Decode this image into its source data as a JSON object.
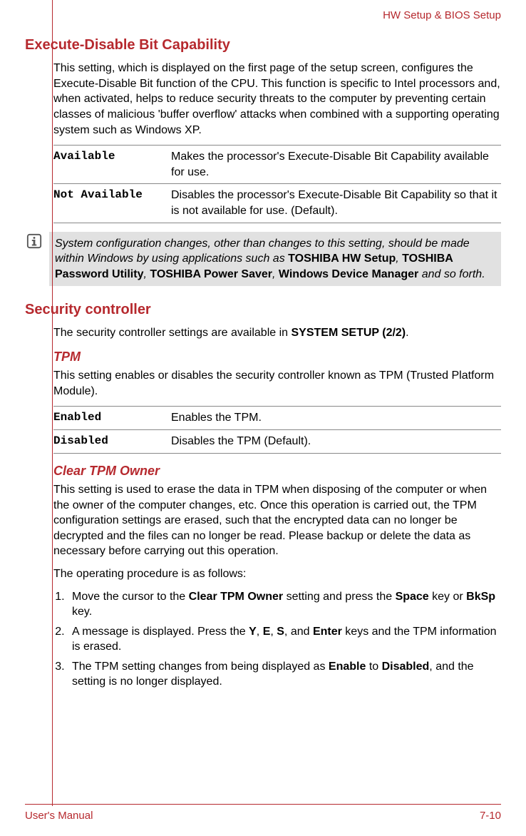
{
  "header": {
    "section": "HW Setup & BIOS Setup"
  },
  "exec": {
    "heading": "Execute-Disable Bit Capability",
    "intro": "This setting, which is displayed on the first page of the setup screen, configures the Execute-Disable Bit function of the CPU. This function is specific to Intel processors and, when activated, helps to reduce security threats to the computer by preventing certain classes of malicious 'buffer overflow' attacks when combined with a supporting operating system such as Windows XP.",
    "rows": [
      {
        "key": "Available",
        "desc": "Makes the processor's Execute-Disable Bit Capability available for use."
      },
      {
        "key": "Not Available",
        "desc": "Disables the processor's Execute-Disable Bit Capability so that it is not available for use. (Default)."
      }
    ]
  },
  "note": {
    "pre": "System configuration changes, other than changes to this setting, should be made within Windows by using applications such as ",
    "b1": "TOSHIBA HW Setup",
    "s1": ", ",
    "b2": "TOSHIBA Password Utility",
    "s2": ", ",
    "b3": "TOSHIBA Power Saver",
    "s3": ", ",
    "b4": "Windows Device Manager",
    "post": " and so forth."
  },
  "sec": {
    "heading": "Security controller",
    "intro_pre": "The security controller settings are available in ",
    "intro_bold": "SYSTEM SETUP (2/2)",
    "intro_post": ".",
    "tpm": {
      "heading": "TPM",
      "intro": "This setting enables or disables the security controller known as TPM (Trusted Platform Module).",
      "rows": [
        {
          "key": "Enabled",
          "desc": "Enables the TPM."
        },
        {
          "key": "Disabled",
          "desc": "Disables the TPM (Default)."
        }
      ]
    },
    "clear": {
      "heading": "Clear TPM Owner",
      "p1": "This setting is used to erase the data in TPM when disposing of the computer or when the owner of the computer changes, etc. Once this operation is carried out, the TPM configuration settings are erased, such that the encrypted data can no longer be decrypted and the files can no longer be read. Please backup or delete the data as necessary before carrying out this operation.",
      "p2": "The operating procedure is as follows:",
      "step1_a": "Move the cursor to the ",
      "step1_b1": "Clear TPM Owner",
      "step1_b": " setting and press the ",
      "step1_b2": "Space",
      "step1_c": " key or ",
      "step1_b3": "BkSp",
      "step1_d": " key.",
      "step2_a": "A message is displayed. Press the ",
      "step2_kY": "Y",
      "step2_s1": ", ",
      "step2_kE": "E",
      "step2_s2": ", ",
      "step2_kS": "S",
      "step2_s3": ", and ",
      "step2_kEnter": "Enter",
      "step2_b": " keys and the TPM information is erased.",
      "step3_a": "The TPM setting changes from being displayed as ",
      "step3_b1": "Enable",
      "step3_b": " to ",
      "step3_b2": "Disabled",
      "step3_c": ", and the setting is no longer displayed."
    }
  },
  "footer": {
    "left": "User's Manual",
    "right": "7-10"
  }
}
